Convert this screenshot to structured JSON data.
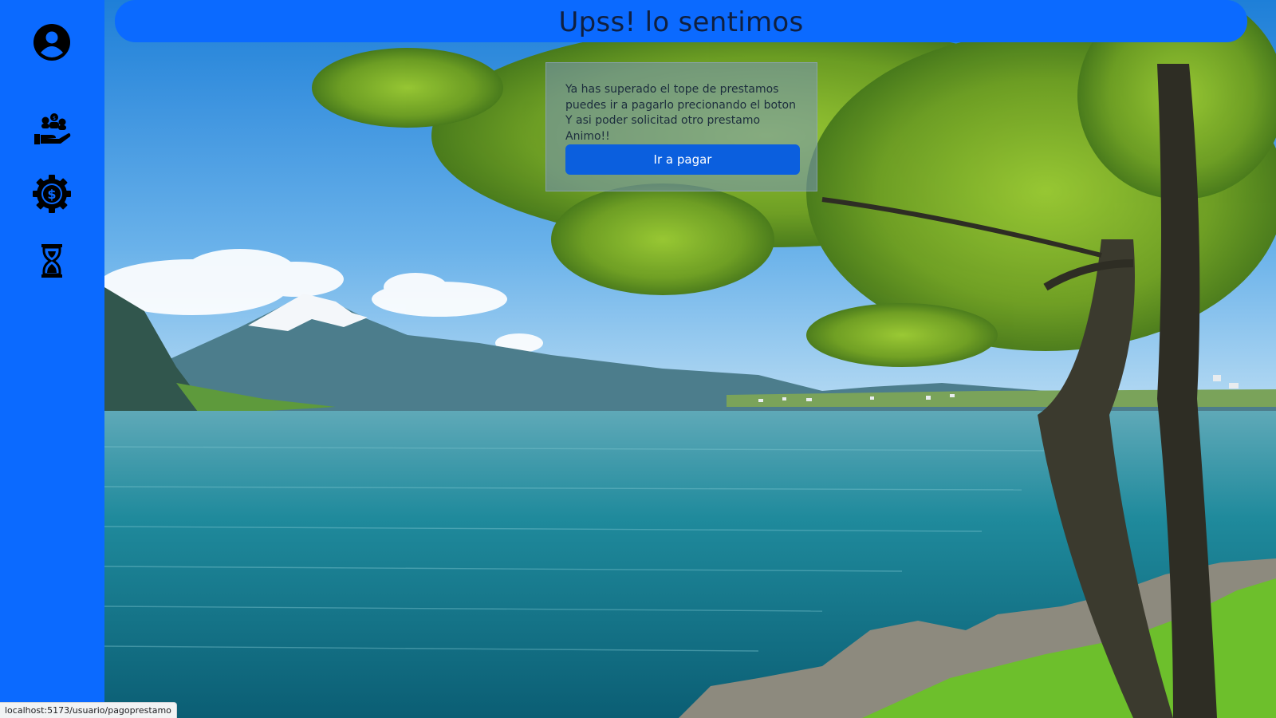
{
  "header": {
    "title": "Upss! lo sentimos"
  },
  "sidebar": {
    "items": [
      {
        "icon": "user-circle-icon"
      },
      {
        "icon": "hand-coins-icon"
      },
      {
        "icon": "gear-dollar-icon"
      },
      {
        "icon": "hourglass-icon"
      }
    ]
  },
  "message": {
    "lines": [
      "Ya has superado el tope de prestamos",
      "puedes ir a pagarlo precionando el boton",
      "Y asi poder solicitad otro prestamo",
      "Animo!!"
    ],
    "button_label": "Ir a pagar"
  },
  "status_bar": {
    "url": "localhost:5173/usuario/pagoprestamo"
  },
  "colors": {
    "accent": "#0b6aff",
    "button": "#0b5fde"
  }
}
